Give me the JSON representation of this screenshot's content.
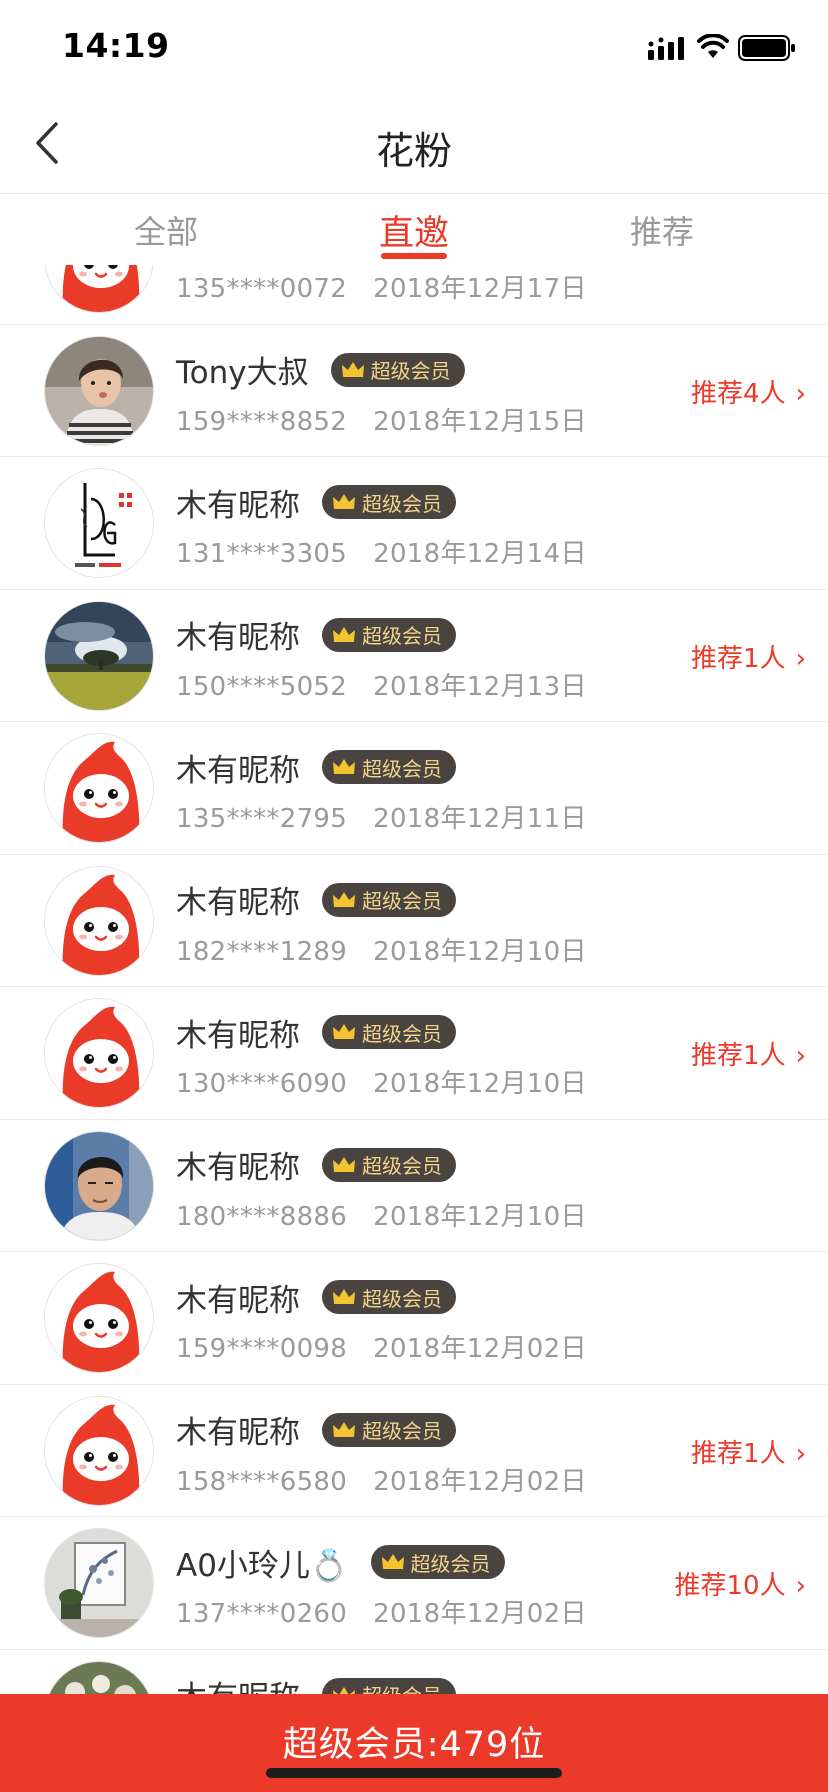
{
  "status_bar": {
    "time": "14:19"
  },
  "nav": {
    "title": "花粉"
  },
  "tabs": [
    {
      "label": "全部",
      "active": false
    },
    {
      "label": "直邀",
      "active": true
    },
    {
      "label": "推荐",
      "active": false
    }
  ],
  "colors": {
    "accent": "#ec3a2a",
    "badge_bg": "#4a4440",
    "badge_text": "#f1d38c"
  },
  "badge_label": "超级会员",
  "members": [
    {
      "avatar": "mascot",
      "name": "",
      "phone": "135****0072",
      "date": "2018年12月17日",
      "recommend": ""
    },
    {
      "avatar": "photo-girl",
      "name": "Tony大叔",
      "phone": "159****8852",
      "date": "2018年12月15日",
      "recommend": "推荐4人"
    },
    {
      "avatar": "logo-ldg",
      "name": "木有昵称",
      "phone": "131****3305",
      "date": "2018年12月14日",
      "recommend": ""
    },
    {
      "avatar": "photo-landscape",
      "name": "木有昵称",
      "phone": "150****5052",
      "date": "2018年12月13日",
      "recommend": "推荐1人"
    },
    {
      "avatar": "mascot",
      "name": "木有昵称",
      "phone": "135****2795",
      "date": "2018年12月11日",
      "recommend": ""
    },
    {
      "avatar": "mascot",
      "name": "木有昵称",
      "phone": "182****1289",
      "date": "2018年12月10日",
      "recommend": ""
    },
    {
      "avatar": "mascot",
      "name": "木有昵称",
      "phone": "130****6090",
      "date": "2018年12月10日",
      "recommend": "推荐1人"
    },
    {
      "avatar": "photo-man",
      "name": "木有昵称",
      "phone": "180****8886",
      "date": "2018年12月10日",
      "recommend": ""
    },
    {
      "avatar": "mascot",
      "name": "木有昵称",
      "phone": "159****0098",
      "date": "2018年12月02日",
      "recommend": ""
    },
    {
      "avatar": "mascot",
      "name": "木有昵称",
      "phone": "158****6580",
      "date": "2018年12月02日",
      "recommend": "推荐1人"
    },
    {
      "avatar": "photo-room",
      "name": "A0小玲儿💍",
      "phone": "137****0260",
      "date": "2018年12月02日",
      "recommend": "推荐10人"
    },
    {
      "avatar": "photo-flowers",
      "name": "木有昵称",
      "phone": "",
      "date": "",
      "recommend": ""
    }
  ],
  "footer": {
    "summary": "超级会员:479位"
  }
}
